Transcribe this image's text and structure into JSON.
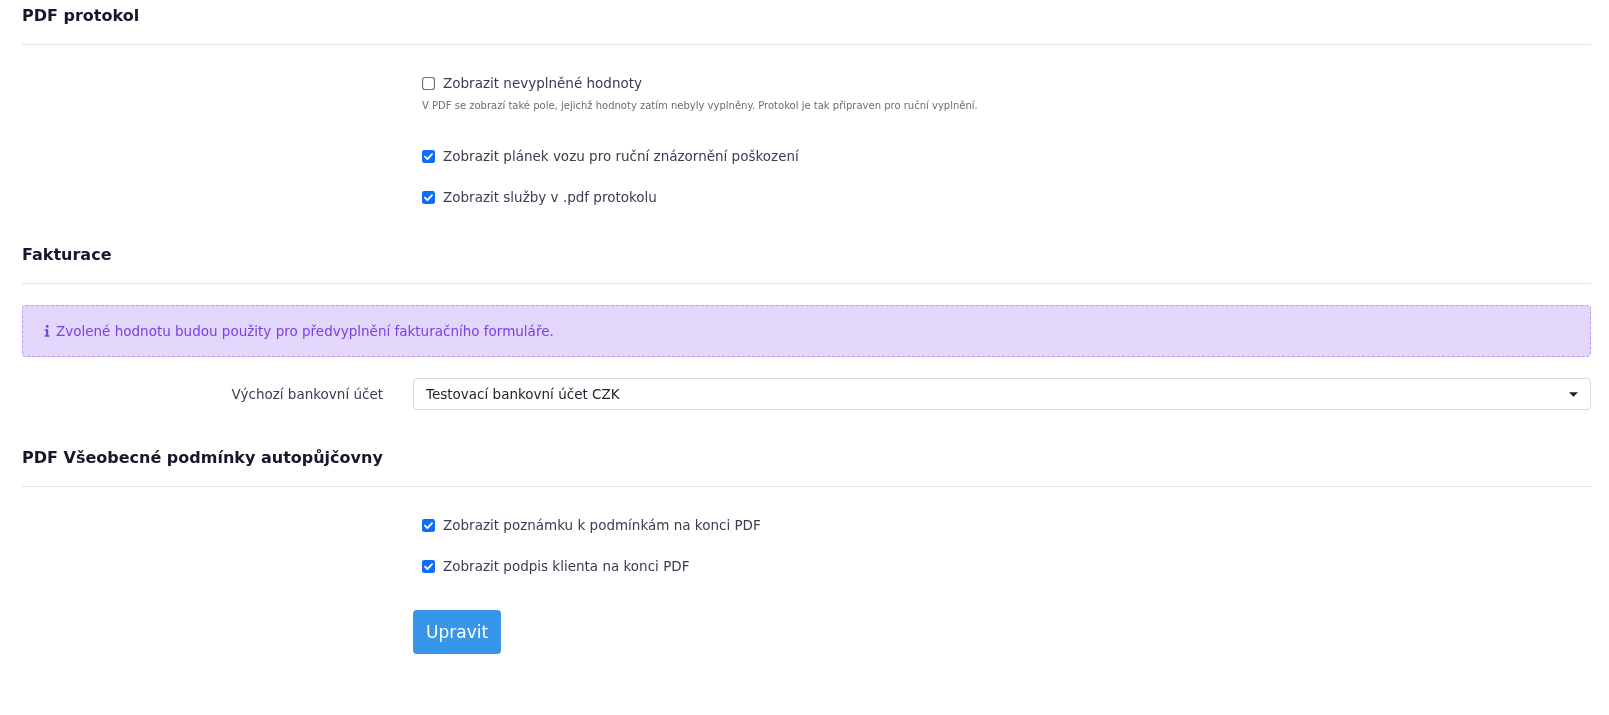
{
  "sections": [
    {
      "title": "PDF protokol",
      "items": [
        {
          "kind": "checkbox",
          "label": "Zobrazit nevyplněné hodnoty",
          "checked": false,
          "help": "V PDF se zobrazí také pole, jejichž hodnoty zatím nebyly vyplněny. Protokol je tak připraven pro ruční vyplnění."
        },
        {
          "kind": "checkbox",
          "label": "Zobrazit plánek vozu pro ruční znázornění poškození",
          "checked": true
        },
        {
          "kind": "checkbox",
          "label": "Zobrazit služby v .pdf protokolu",
          "checked": true
        }
      ]
    },
    {
      "title": "Fakturace",
      "items": [
        {
          "kind": "alert",
          "text": "Zvolené hodnotu budou použity pro předvyplnění fakturačního formuláře."
        },
        {
          "kind": "select",
          "label": "Výchozí bankovní účet",
          "value": "Testovací bankovní účet CZK"
        }
      ]
    },
    {
      "title": "PDF Všeobecné podmínky autopůjčovny",
      "items": [
        {
          "kind": "checkbox",
          "label": "Zobrazit poznámku k podmínkám na konci PDF",
          "checked": true
        },
        {
          "kind": "checkbox",
          "label": "Zobrazit podpis klienta na konci PDF",
          "checked": true
        }
      ]
    }
  ],
  "submit_button": {
    "label": "Upravit"
  }
}
